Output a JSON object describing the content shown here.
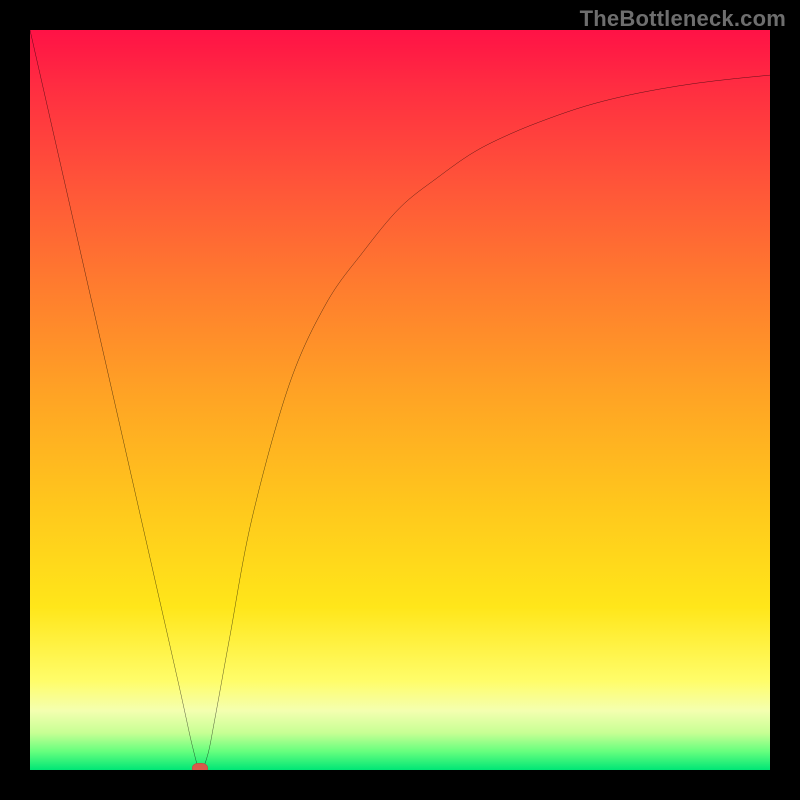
{
  "watermark": "TheBottleneck.com",
  "colors": {
    "frame": "#000000",
    "marker": "#d85a4a",
    "curve": "#000000",
    "gradient_stops": [
      "#ff1246",
      "#ff2e41",
      "#ff5838",
      "#ff7d2e",
      "#ffa524",
      "#ffc91c",
      "#ffe61a",
      "#fffd6a",
      "#f4ffb0",
      "#c7ff94",
      "#66ff7e",
      "#00e676"
    ]
  },
  "chart_data": {
    "type": "line",
    "title": "",
    "xlabel": "",
    "ylabel": "",
    "xlim": [
      0,
      100
    ],
    "ylim": [
      0,
      100
    ],
    "x": [
      0,
      5,
      10,
      15,
      20,
      22,
      23,
      24,
      25,
      27,
      30,
      35,
      40,
      45,
      50,
      55,
      60,
      65,
      70,
      75,
      80,
      85,
      90,
      95,
      100
    ],
    "y": [
      100,
      78,
      56,
      34,
      12,
      3,
      0,
      2,
      7,
      18,
      34,
      52,
      63,
      70,
      76,
      80,
      83.5,
      86,
      88,
      89.7,
      91,
      92,
      92.8,
      93.4,
      93.9
    ],
    "marker": {
      "x": 23,
      "y": 0
    },
    "notes": "V-shaped bottleneck curve: linear descent from top-left to a minimum near x≈23, then a concave ascent that saturates toward the right edge."
  }
}
